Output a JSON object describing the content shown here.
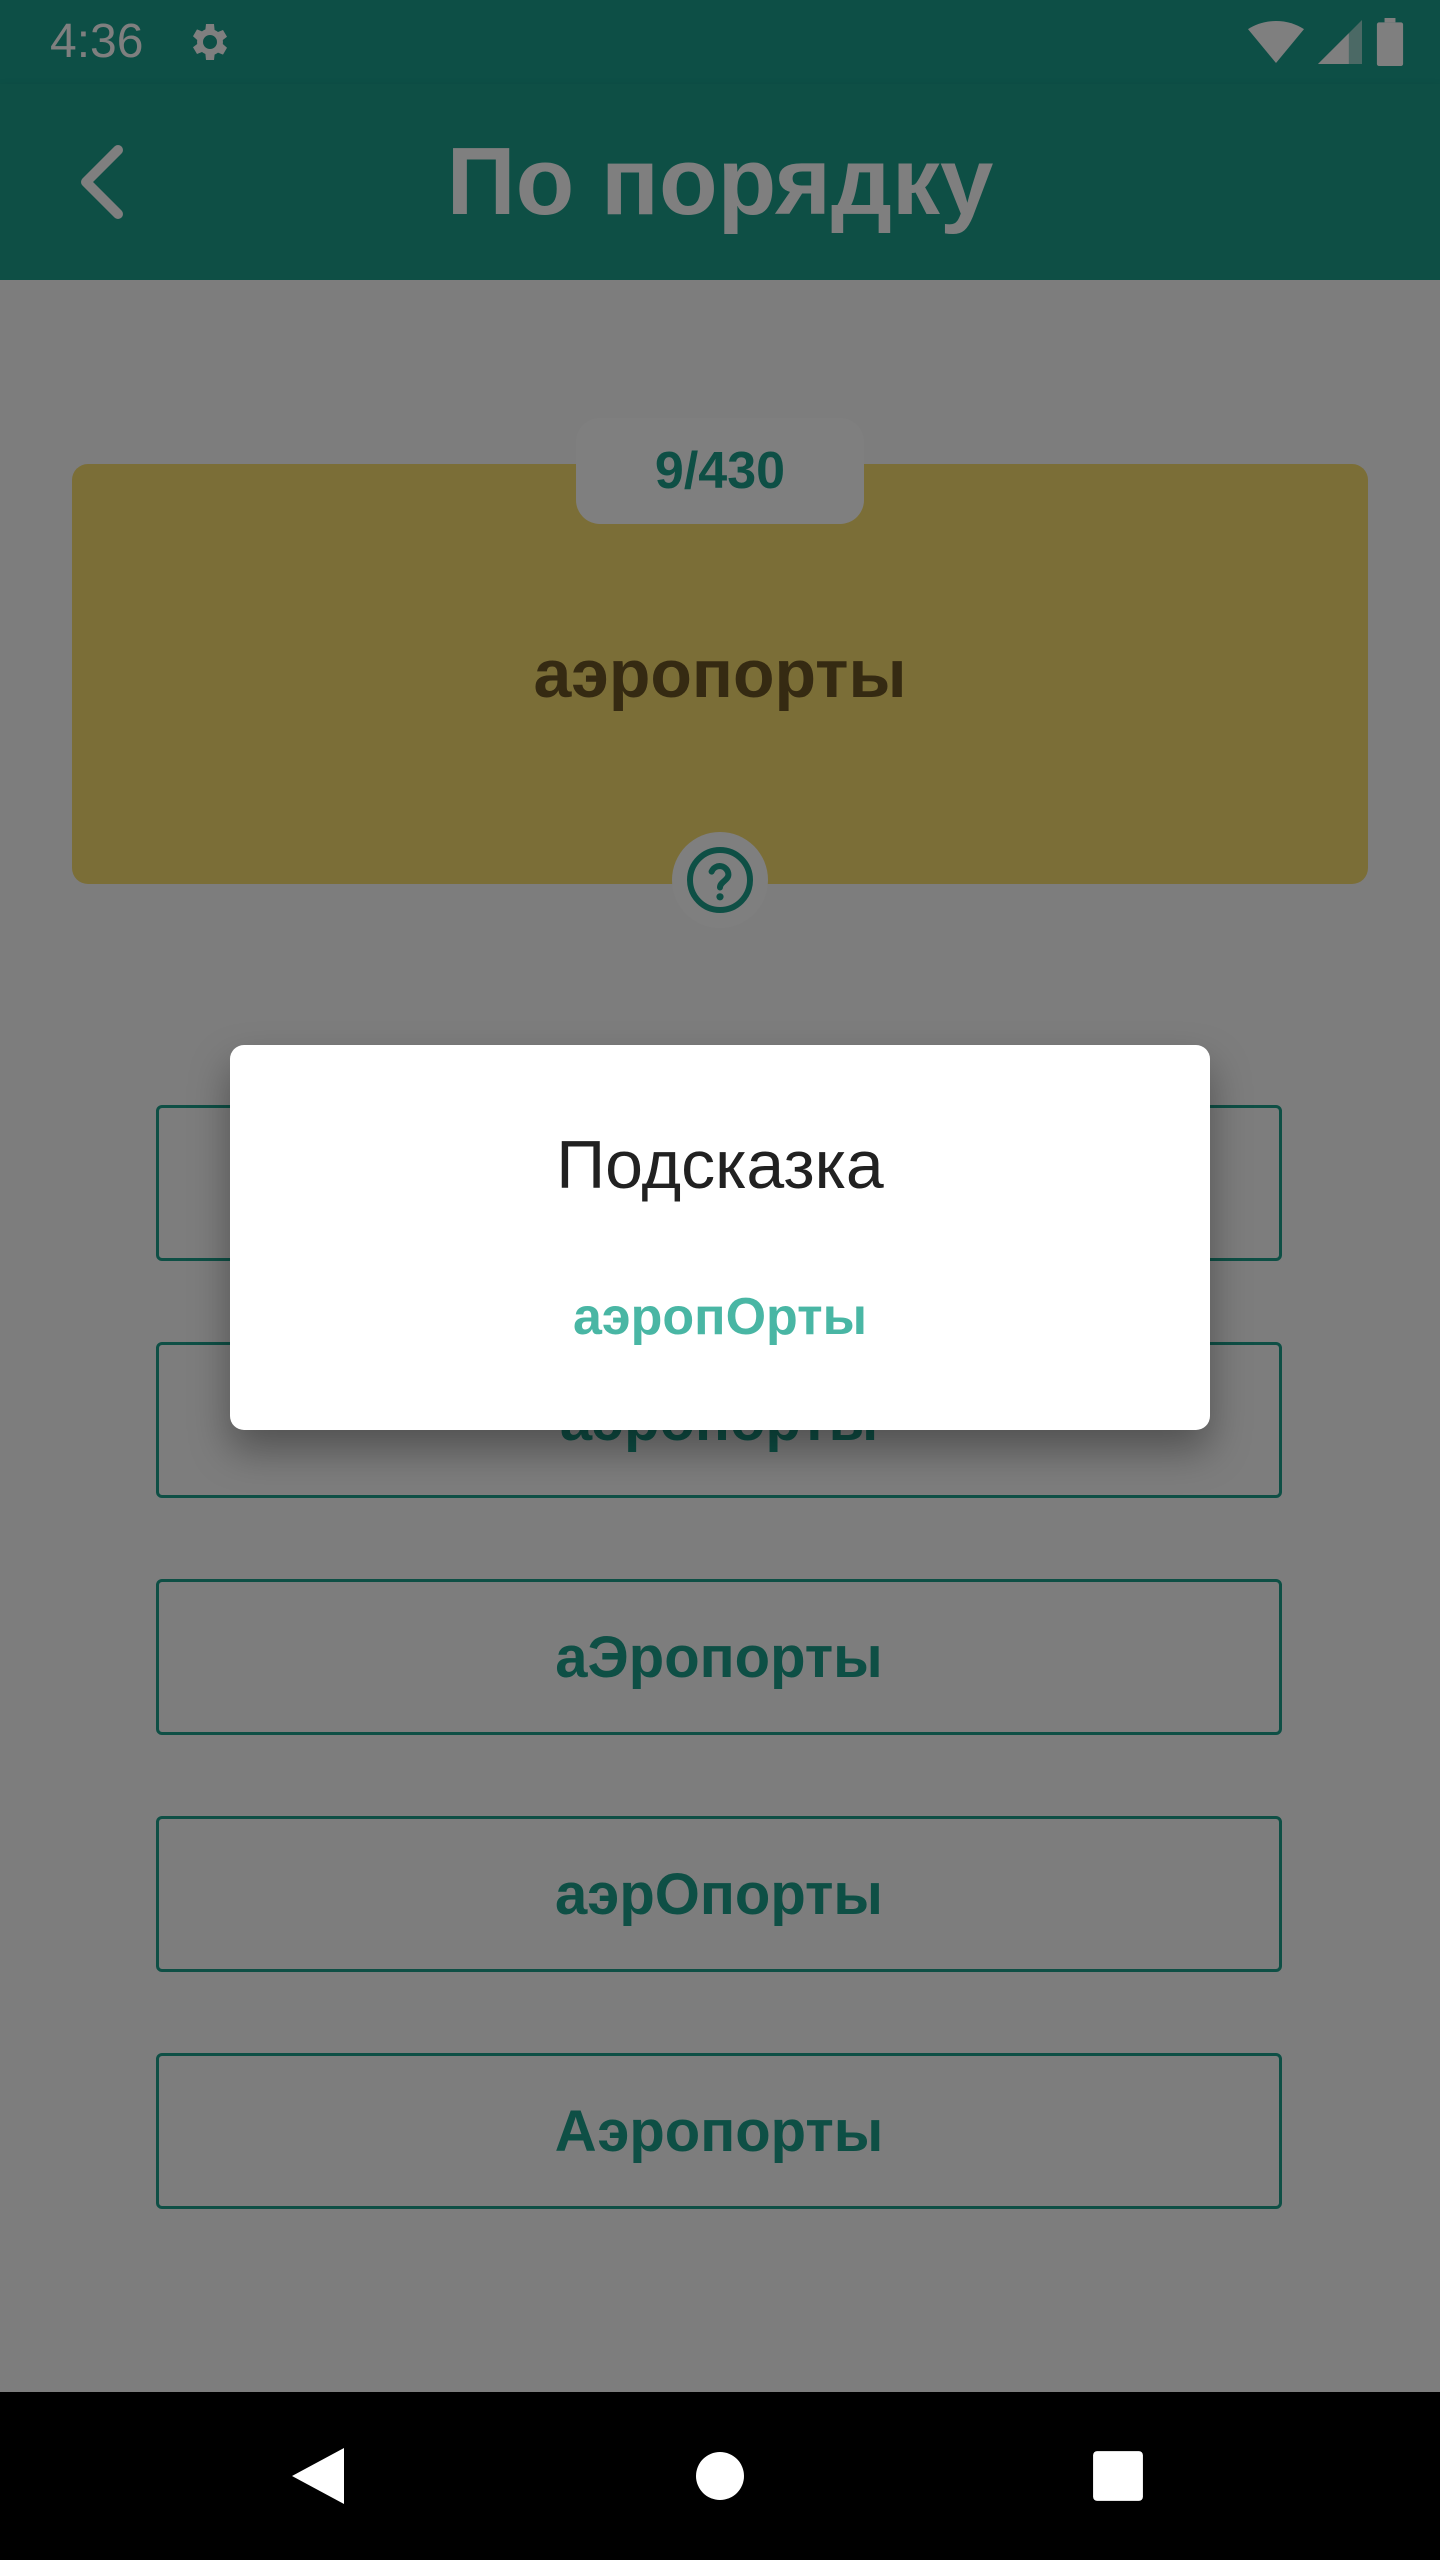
{
  "status_bar": {
    "time": "4:36",
    "icons": [
      "settings-icon",
      "wifi-icon",
      "signal-icon",
      "battery-icon"
    ]
  },
  "app_bar": {
    "title": "По порядку",
    "back_icon": "chevron-left-icon"
  },
  "card": {
    "counter": "9/430",
    "word": "аэропорты",
    "hint_icon": "question-circle-icon"
  },
  "options": [
    {
      "label": ""
    },
    {
      "label": "аэропорты"
    },
    {
      "label": "аЭропорты"
    },
    {
      "label": "аэрОпорты"
    },
    {
      "label": "Аэропорты"
    }
  ],
  "dialog": {
    "title": "Подсказка",
    "hint": "аэропОрты"
  },
  "colors": {
    "primary": "#1c9e8b",
    "card": "#f7dc6f",
    "hint_text": "#49b6a4"
  }
}
